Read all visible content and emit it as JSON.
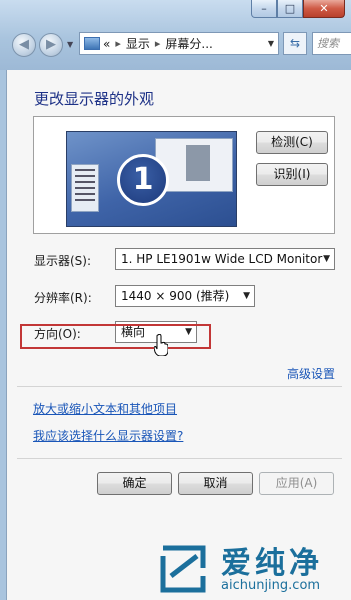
{
  "window": {
    "caption_buttons": {
      "minimize_icon": "minimize-icon",
      "maximize_icon": "maximize-icon",
      "close_icon": "close-icon"
    }
  },
  "navbar": {
    "back_icon": "arrow-left-icon",
    "forward_icon": "arrow-right-icon",
    "address": {
      "overflow": "«",
      "crumb1": "显示",
      "crumb2": "屏幕分...",
      "separator": "▸"
    },
    "refresh_icon": "refresh-icon",
    "search_placeholder": "搜索"
  },
  "dialog": {
    "title": "更改显示器的外观",
    "preview": {
      "monitor_number": "1"
    },
    "buttons": {
      "detect": "检测(C)",
      "identify": "识别(I)"
    },
    "fields": {
      "display": {
        "label": "显示器(S):",
        "value": "1. HP LE1901w Wide LCD Monitor"
      },
      "resolution": {
        "label": "分辨率(R):",
        "value": "1440 × 900 (推荐)"
      },
      "orientation": {
        "label": "方向(O):",
        "value": "横向"
      }
    },
    "advanced_link": "高级设置",
    "links": {
      "text_size": "放大或缩小文本和其他项目",
      "which_settings": "我应该选择什么显示器设置?"
    },
    "footer": {
      "ok": "确定",
      "cancel": "取消",
      "apply": "应用(A)"
    }
  },
  "colors": {
    "link": "#1a56b8",
    "highlight_box": "#c23636",
    "watermark": "#1b6f9c"
  },
  "watermark": {
    "title": "爱纯净",
    "subtitle": "aichunjing.com"
  }
}
